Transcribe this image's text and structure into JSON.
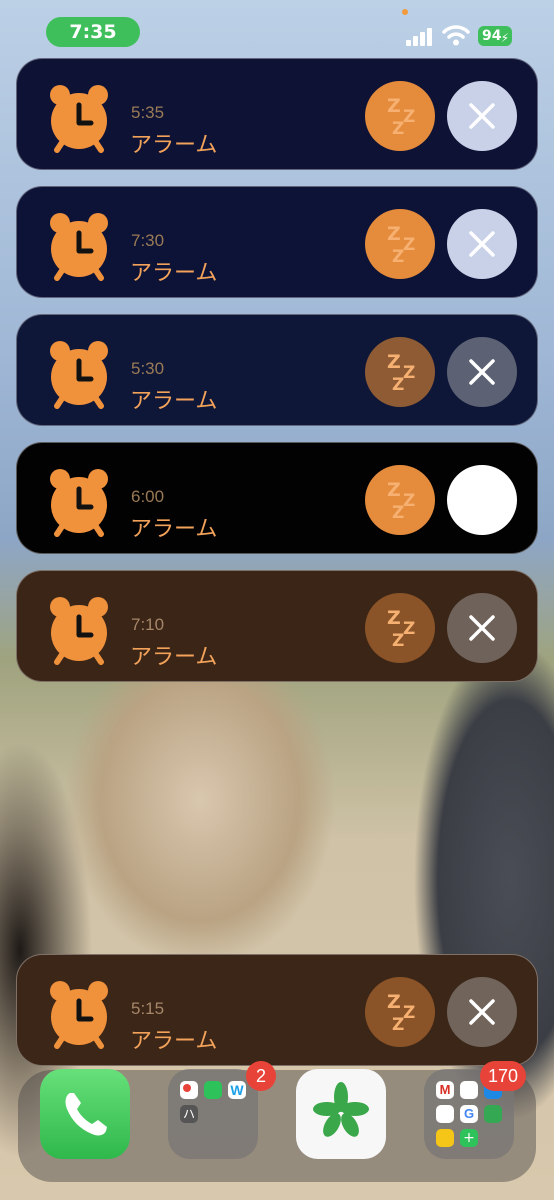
{
  "status_bar": {
    "time": "7:35",
    "battery": "94",
    "colors": {
      "pill": "#3fbf5b"
    }
  },
  "alarms": [
    {
      "time": "5:35",
      "label": "アラーム"
    },
    {
      "time": "7:30",
      "label": "アラーム"
    },
    {
      "time": "5:30",
      "label": "アラーム"
    },
    {
      "time": "6:00",
      "label": "アラーム"
    },
    {
      "time": "7:10",
      "label": "アラーム"
    },
    {
      "time": "5:15",
      "label": "アラーム"
    }
  ],
  "icons": {
    "alarm": "alarm-clock-icon",
    "snooze": "zzz-snooze-icon",
    "dismiss": "close-x-icon"
  },
  "dock": {
    "folder1_badge": "2",
    "folder1_letter": "ハ",
    "folder2_badge": "170"
  }
}
